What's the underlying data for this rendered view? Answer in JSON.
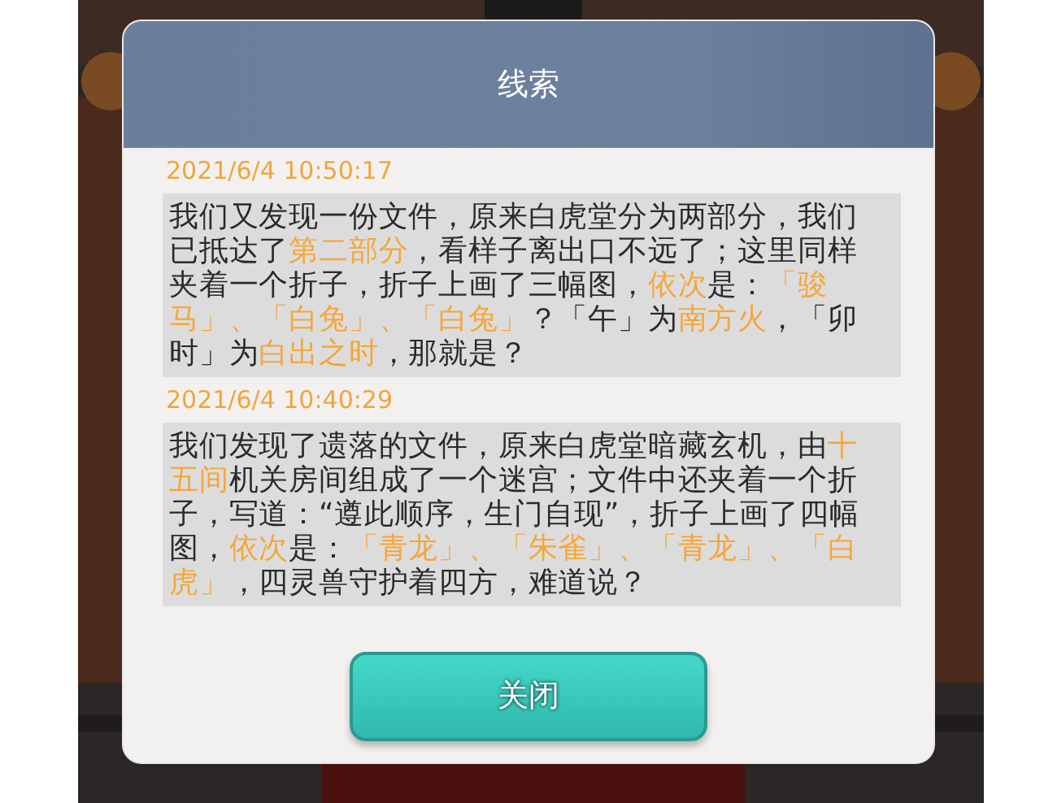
{
  "dialog": {
    "title": "线索",
    "messages": [
      {
        "time": "2021/6/4 10:50:17",
        "segments": [
          {
            "text": "我们又发现一份文件，原来白虎堂分为两部分，我们已抵达了",
            "highlight": false
          },
          {
            "text": "第二部分",
            "highlight": true
          },
          {
            "text": "，看样子离出口不远了；这里同样夹着一个折子，折子上画了三幅图，",
            "highlight": false
          },
          {
            "text": "依次",
            "highlight": true
          },
          {
            "text": "是：",
            "highlight": false
          },
          {
            "text": "「骏马」、「白兔」、「白兔」",
            "highlight": true
          },
          {
            "text": "？「午」为",
            "highlight": false
          },
          {
            "text": "南方火",
            "highlight": true
          },
          {
            "text": "，「卯时」为",
            "highlight": false
          },
          {
            "text": "白出之时",
            "highlight": true
          },
          {
            "text": "，那就是？",
            "highlight": false
          }
        ]
      },
      {
        "time": "2021/6/4 10:40:29",
        "segments": [
          {
            "text": "我们发现了遗落的文件，原来白虎堂暗藏玄机，由",
            "highlight": false
          },
          {
            "text": "十五间",
            "highlight": true
          },
          {
            "text": "机关房间组成了一个迷宫；文件中还夹着一个折子，写道：“遵此顺序，生门自现”，折子上画了四幅图，",
            "highlight": false
          },
          {
            "text": "依次",
            "highlight": true
          },
          {
            "text": "是：",
            "highlight": false
          },
          {
            "text": "「青龙」、「朱雀」、「青龙」、「白虎」",
            "highlight": true
          },
          {
            "text": "，四灵兽守护着四方，难道说？",
            "highlight": false
          }
        ]
      }
    ],
    "button": "关闭"
  }
}
